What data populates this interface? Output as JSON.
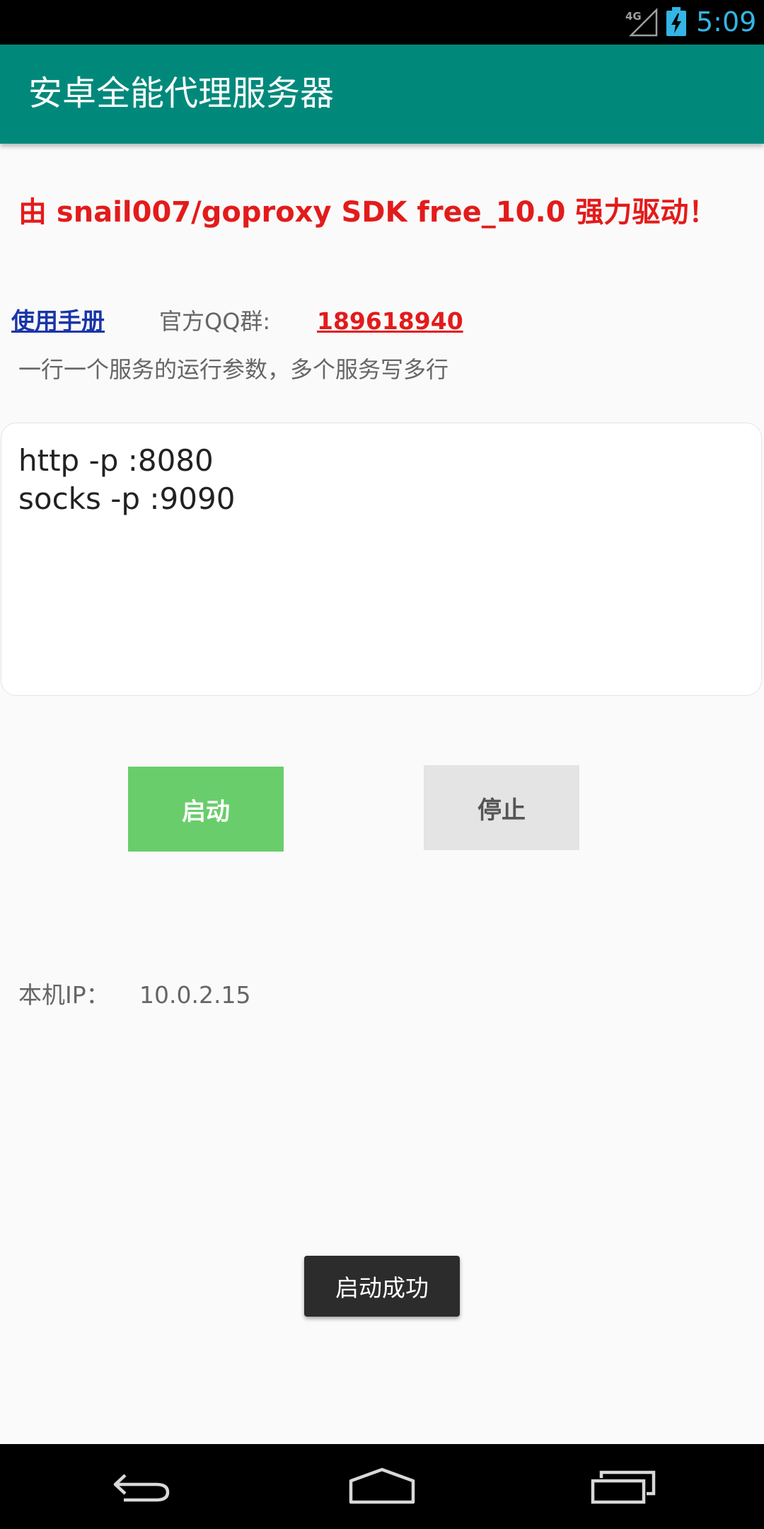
{
  "status_bar": {
    "network": "4G",
    "time": "5:09",
    "signal_icon": "signal-icon",
    "battery_icon": "battery-charging-icon"
  },
  "app_bar": {
    "title": "安卓全能代理服务器"
  },
  "main": {
    "powered_by": "由 snail007/goproxy SDK free_10.0 强力驱动！",
    "manual_link": "使用手册",
    "qq_label": "官方QQ群:",
    "qq_number": "189618940",
    "hint": "一行一个服务的运行参数，多个服务写多行",
    "params_value": "http -p :8080\nsocks -p :9090",
    "start_button": "启动",
    "stop_button": "停止",
    "ip_label": "本机IP：",
    "ip_value": "10.0.2.15"
  },
  "toast": {
    "message": "启动成功"
  },
  "nav_bar": {
    "back_icon": "back-icon",
    "home_icon": "home-icon",
    "recent_icon": "recent-apps-icon"
  },
  "colors": {
    "app_bar": "#00897b",
    "powered_by_text": "#e31b1b",
    "manual_link": "#1a35a8",
    "start_button": "#6acd6b",
    "stop_button": "#e4e4e4",
    "clock": "#33b5e5"
  }
}
